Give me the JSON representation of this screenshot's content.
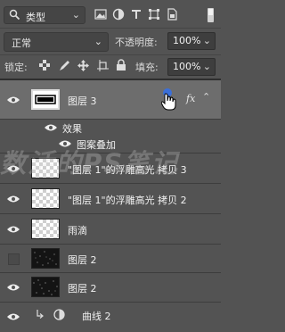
{
  "toolbar": {
    "filter_kind": "类型",
    "filter_icons": [
      "image-icon",
      "adjustment-icon",
      "text-icon",
      "shape-icon",
      "smart-object-icon"
    ],
    "blend_mode": "正常",
    "opacity_label": "不透明度:",
    "opacity_value": "100%",
    "lock_label": "锁定:",
    "fill_label": "填充:",
    "fill_value": "100%"
  },
  "layers": [
    {
      "name": "图层 3",
      "visible": true,
      "selected": true,
      "fx": "fx"
    },
    {
      "effects_header": "效果"
    },
    {
      "effect_name": "图案叠加"
    },
    {
      "name": "\"图层 1\"的浮雕高光 拷贝 3",
      "visible": true
    },
    {
      "name": "\"图层 1\"的浮雕高光 拷贝 2",
      "visible": true
    },
    {
      "name": "雨滴",
      "visible": true
    },
    {
      "name": "图层 2",
      "visible": false
    },
    {
      "name": "图层 2",
      "visible": true
    },
    {
      "name": "曲线 2",
      "visible": true
    }
  ],
  "watermark": "数活的PS笔记"
}
